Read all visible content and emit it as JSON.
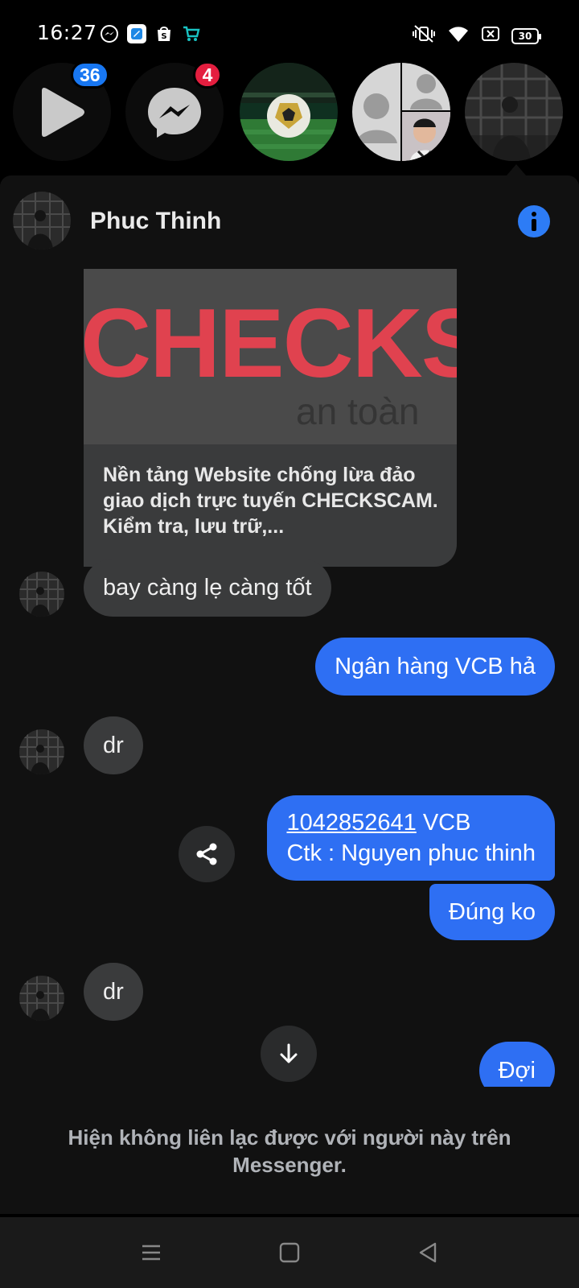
{
  "status_bar": {
    "time": "16:27",
    "battery": "30",
    "left_icons": [
      "messenger-icon",
      "blue-app-icon",
      "shopee-icon",
      "cart-app-icon"
    ],
    "right_icons": [
      "mute-vibrate-icon",
      "wifi-icon",
      "data-saver-icon",
      "battery-icon"
    ]
  },
  "chat_heads": [
    {
      "name": "video-chat-head",
      "icon": "play-icon",
      "badge": "36",
      "badge_color": "#1877f2"
    },
    {
      "name": "messenger-chat-head",
      "icon": "messenger-icon",
      "badge": "4",
      "badge_color": "#e41e3f"
    },
    {
      "name": "football-chat-head",
      "icon": "soccer-ball-photo"
    },
    {
      "name": "group-chat-head",
      "icon": "group-avatar-photo"
    },
    {
      "name": "phuc-thinh-chat-head",
      "icon": "dark-portrait-photo",
      "active": true
    }
  ],
  "conversation": {
    "contact_name": "Phuc Thinh",
    "link_preview": {
      "image_text": "CHECKSC",
      "image_subtext": "an toàn",
      "text": "Nền tảng Website chống lừa đảo giao dịch trực tuyến CHECKSCAM. Kiểm tra, lưu trữ,..."
    },
    "messages": [
      {
        "from": "them",
        "text": "bay càng lẹ càng tốt"
      },
      {
        "from": "me",
        "text": "Ngân hàng VCB hả"
      },
      {
        "from": "them",
        "text": "dr"
      },
      {
        "from": "me",
        "link": "1042852641",
        "text_after_link": " VCB",
        "line2": "Ctk : Nguyen phuc thinh"
      },
      {
        "from": "me",
        "text": "Đúng ko"
      },
      {
        "from": "them",
        "text": "dr"
      },
      {
        "from": "me",
        "text": "Đợi"
      }
    ],
    "notice": "Hiện không liên lạc được với người này trên Messenger."
  },
  "colors": {
    "accent": "#2e6ff3",
    "incoming_bubble": "#3a3b3c",
    "panel": "#111111",
    "info": "#2d7cf6"
  }
}
